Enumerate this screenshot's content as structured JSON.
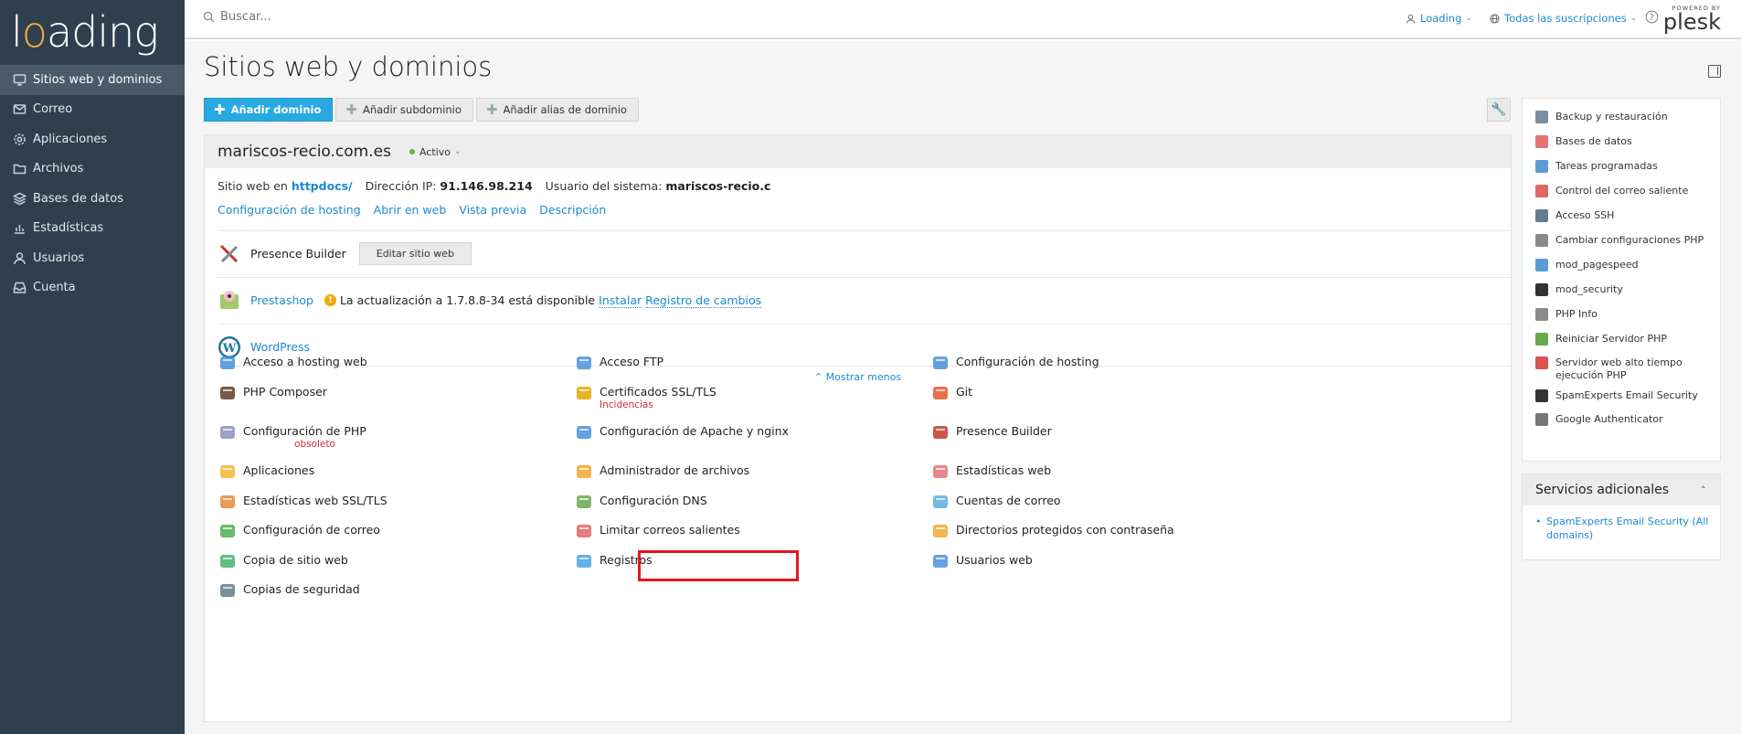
{
  "brand": {
    "logo_pre": "l",
    "logo_o": "o",
    "logo_post": "ading"
  },
  "sidebar": {
    "items": [
      {
        "label": "Sitios web y dominios",
        "icon": "monitor-icon"
      },
      {
        "label": "Correo",
        "icon": "mail-icon"
      },
      {
        "label": "Aplicaciones",
        "icon": "gear-icon"
      },
      {
        "label": "Archivos",
        "icon": "folder-icon"
      },
      {
        "label": "Bases de datos",
        "icon": "layers-icon"
      },
      {
        "label": "Estadísticas",
        "icon": "bar-chart-icon"
      },
      {
        "label": "Usuarios",
        "icon": "user-icon"
      },
      {
        "label": "Cuenta",
        "icon": "inbox-icon"
      }
    ]
  },
  "header": {
    "search_placeholder": "Buscar...",
    "user": "Loading",
    "subscriptions": "Todas las suscripciones",
    "powered_by": "POWERED BY",
    "plesk": "plesk"
  },
  "page": {
    "title": "Sitios web y dominios"
  },
  "toolbar": {
    "add_domain": "Añadir dominio",
    "add_subdomain": "Añadir subdominio",
    "add_alias": "Añadir alias de dominio"
  },
  "domain": {
    "name": "mariscos-recio.com.es",
    "status": "Activo",
    "site_prefix": "Sitio web en",
    "site_path": "httpdocs/",
    "ip_label": "Dirección IP:",
    "ip": "91.146.98.214",
    "sysuser_label": "Usuario del sistema:",
    "sysuser": "mariscos-recio.c",
    "links": [
      "Configuración de hosting",
      "Abrir en web",
      "Vista previa",
      "Descripción"
    ]
  },
  "apps": {
    "presence": {
      "name": "Presence Builder",
      "button": "Editar sitio web"
    },
    "prestashop": {
      "name": "Prestashop",
      "update": "La actualización a 1.7.8.8-34 está disponible",
      "install": "Instalar",
      "changelog": "Registro de cambios"
    },
    "wordpress": {
      "name": "WordPress"
    }
  },
  "show_less": "⌃ Mostrar menos",
  "tools": {
    "col1": [
      {
        "label": "Acceso a hosting web",
        "icon": "globe-person-icon",
        "color": "#4a90d9"
      },
      {
        "label": "PHP Composer",
        "icon": "composer-icon",
        "color": "#5a3d2b"
      },
      {
        "label": "Configuración de PHP",
        "icon": "php-icon",
        "color": "#8892bf",
        "sub": "obsoleto"
      },
      {
        "label": "Aplicaciones",
        "icon": "gear-icon",
        "color": "#f2b632"
      },
      {
        "label": "Estadísticas web SSL/TLS",
        "icon": "stats-lock-icon",
        "color": "#e8893a"
      },
      {
        "label": "Configuración de correo",
        "icon": "mail-settings-icon",
        "color": "#4caf50"
      },
      {
        "label": "Copia de sitio web",
        "icon": "copy-icon",
        "color": "#45b36b"
      },
      {
        "label": "Copias de seguridad",
        "icon": "backup-icon",
        "color": "#607d8b"
      }
    ],
    "col2": [
      {
        "label": "Acceso FTP",
        "icon": "ftp-icon",
        "color": "#4a90d9"
      },
      {
        "label": "Certificados SSL/TLS",
        "icon": "lock-icon",
        "color": "#e0a800",
        "sub": "Incidencias"
      },
      {
        "label": "Configuración de Apache y nginx",
        "icon": "server-icon",
        "color": "#4a90d9"
      },
      {
        "label": "Administrador de archivos",
        "icon": "folder-icon",
        "color": "#f0a830"
      },
      {
        "label": "Configuración DNS",
        "icon": "dns-flag-icon",
        "color": "#6aa84f"
      },
      {
        "label": "Limitar correos salientes",
        "icon": "mail-limit-icon",
        "color": "#e06666"
      },
      {
        "label": "Registros",
        "icon": "logs-icon",
        "color": "#4aa3df"
      }
    ],
    "col3": [
      {
        "label": "Configuración de hosting",
        "icon": "hosting-settings-icon",
        "color": "#4a90d9"
      },
      {
        "label": "Git",
        "icon": "git-icon",
        "color": "#e8562a"
      },
      {
        "label": "Presence Builder",
        "icon": "tools-icon",
        "color": "#c0392b"
      },
      {
        "label": "Estadísticas web",
        "icon": "stats-icon",
        "color": "#e57373"
      },
      {
        "label": "Cuentas de correo",
        "icon": "mail-icon",
        "color": "#5dade2"
      },
      {
        "label": "Directorios protegidos con contraseña",
        "icon": "folder-lock-icon",
        "color": "#f0a830"
      },
      {
        "label": "Usuarios web",
        "icon": "web-users-icon",
        "color": "#4a90d9"
      }
    ]
  },
  "right_panel": {
    "items": [
      {
        "label": "Backup y restauración",
        "icon": "backup-icon",
        "color": "#7b8fa3"
      },
      {
        "label": "Bases de datos",
        "icon": "database-icon",
        "color": "#e57373"
      },
      {
        "label": "Tareas programadas",
        "icon": "calendar-icon",
        "color": "#5b9bd5"
      },
      {
        "label": "Control del correo saliente",
        "icon": "mail-icon",
        "color": "#e06666"
      },
      {
        "label": "Acceso SSH",
        "icon": "terminal-icon",
        "color": "#607d8b"
      },
      {
        "label": "Cambiar configuraciones PHP",
        "icon": "php-settings-icon",
        "color": "#8a8a8a"
      },
      {
        "label": "mod_pagespeed",
        "icon": "pagespeed-icon",
        "color": "#5b9bd5"
      },
      {
        "label": "mod_security",
        "icon": "shield-icon",
        "color": "#333"
      },
      {
        "label": "PHP Info",
        "icon": "php-info-icon",
        "color": "#8a8a8a"
      },
      {
        "label": "Reiniciar Servidor PHP",
        "icon": "restart-icon",
        "color": "#6aa84f"
      },
      {
        "label": "Servidor web alto tiempo ejecución PHP",
        "icon": "clock-icon",
        "color": "#d9534f"
      },
      {
        "label": "SpamExperts Email Security",
        "icon": "spam-icon",
        "color": "#333"
      },
      {
        "label": "Google Authenticator",
        "icon": "authenticator-icon",
        "color": "#777"
      }
    ]
  },
  "additional_services": {
    "title": "Servicios adicionales",
    "items": [
      "SpamExperts Email Security (All domains)"
    ]
  }
}
